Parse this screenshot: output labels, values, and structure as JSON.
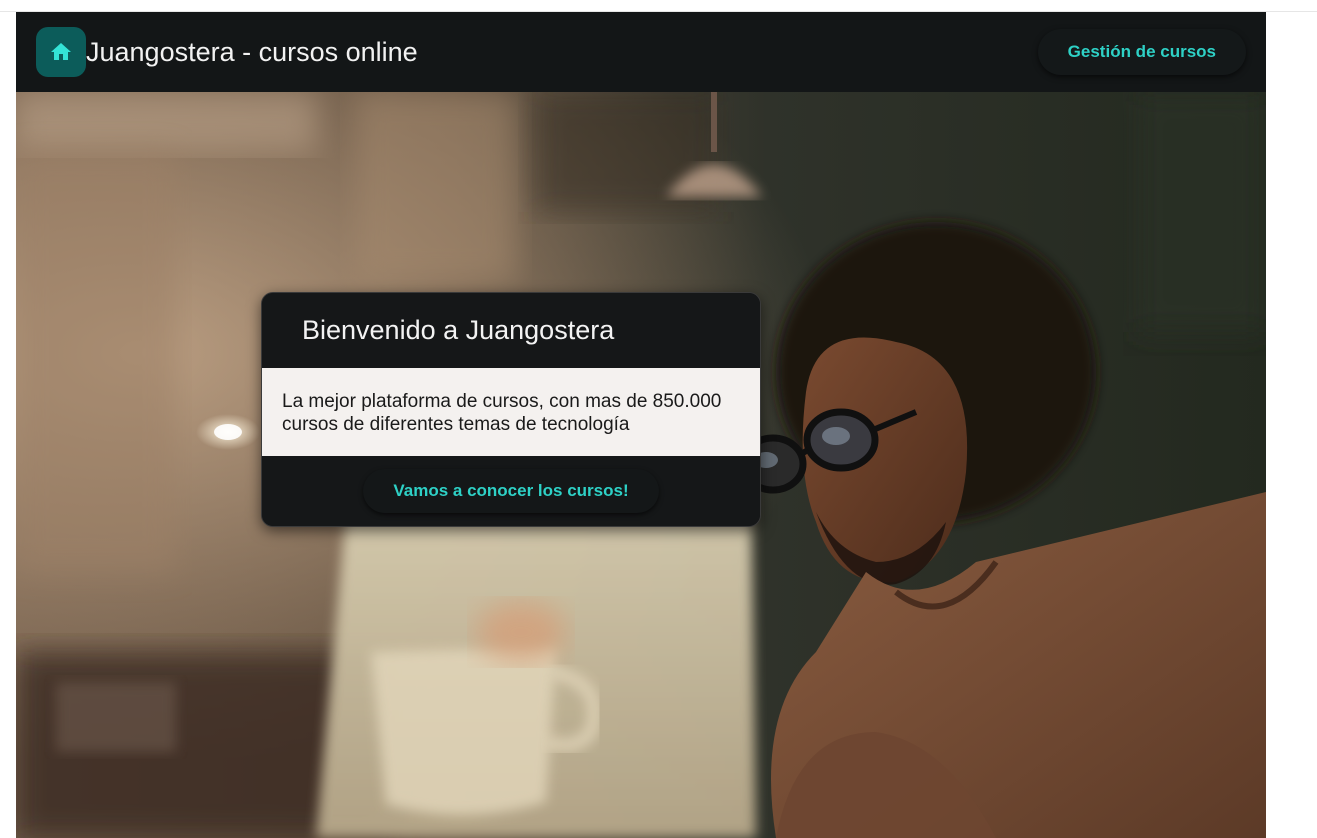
{
  "header": {
    "title": "Juangostera - cursos online",
    "home_icon": "home-icon",
    "manage_label": "Gestión de cursos"
  },
  "welcome_card": {
    "title": "Bienvenido a Juangostera",
    "description": "La mejor plataforma de cursos, con mas de 850.000 cursos de diferentes temas de tecnología",
    "cta_label": "Vamos a conocer los cursos!"
  },
  "colors": {
    "toolbar_bg": "#131617",
    "accent": "#2ed1c6",
    "home_button_bg": "#0c5c5a",
    "card_body_bg": "#f4f1ef"
  }
}
